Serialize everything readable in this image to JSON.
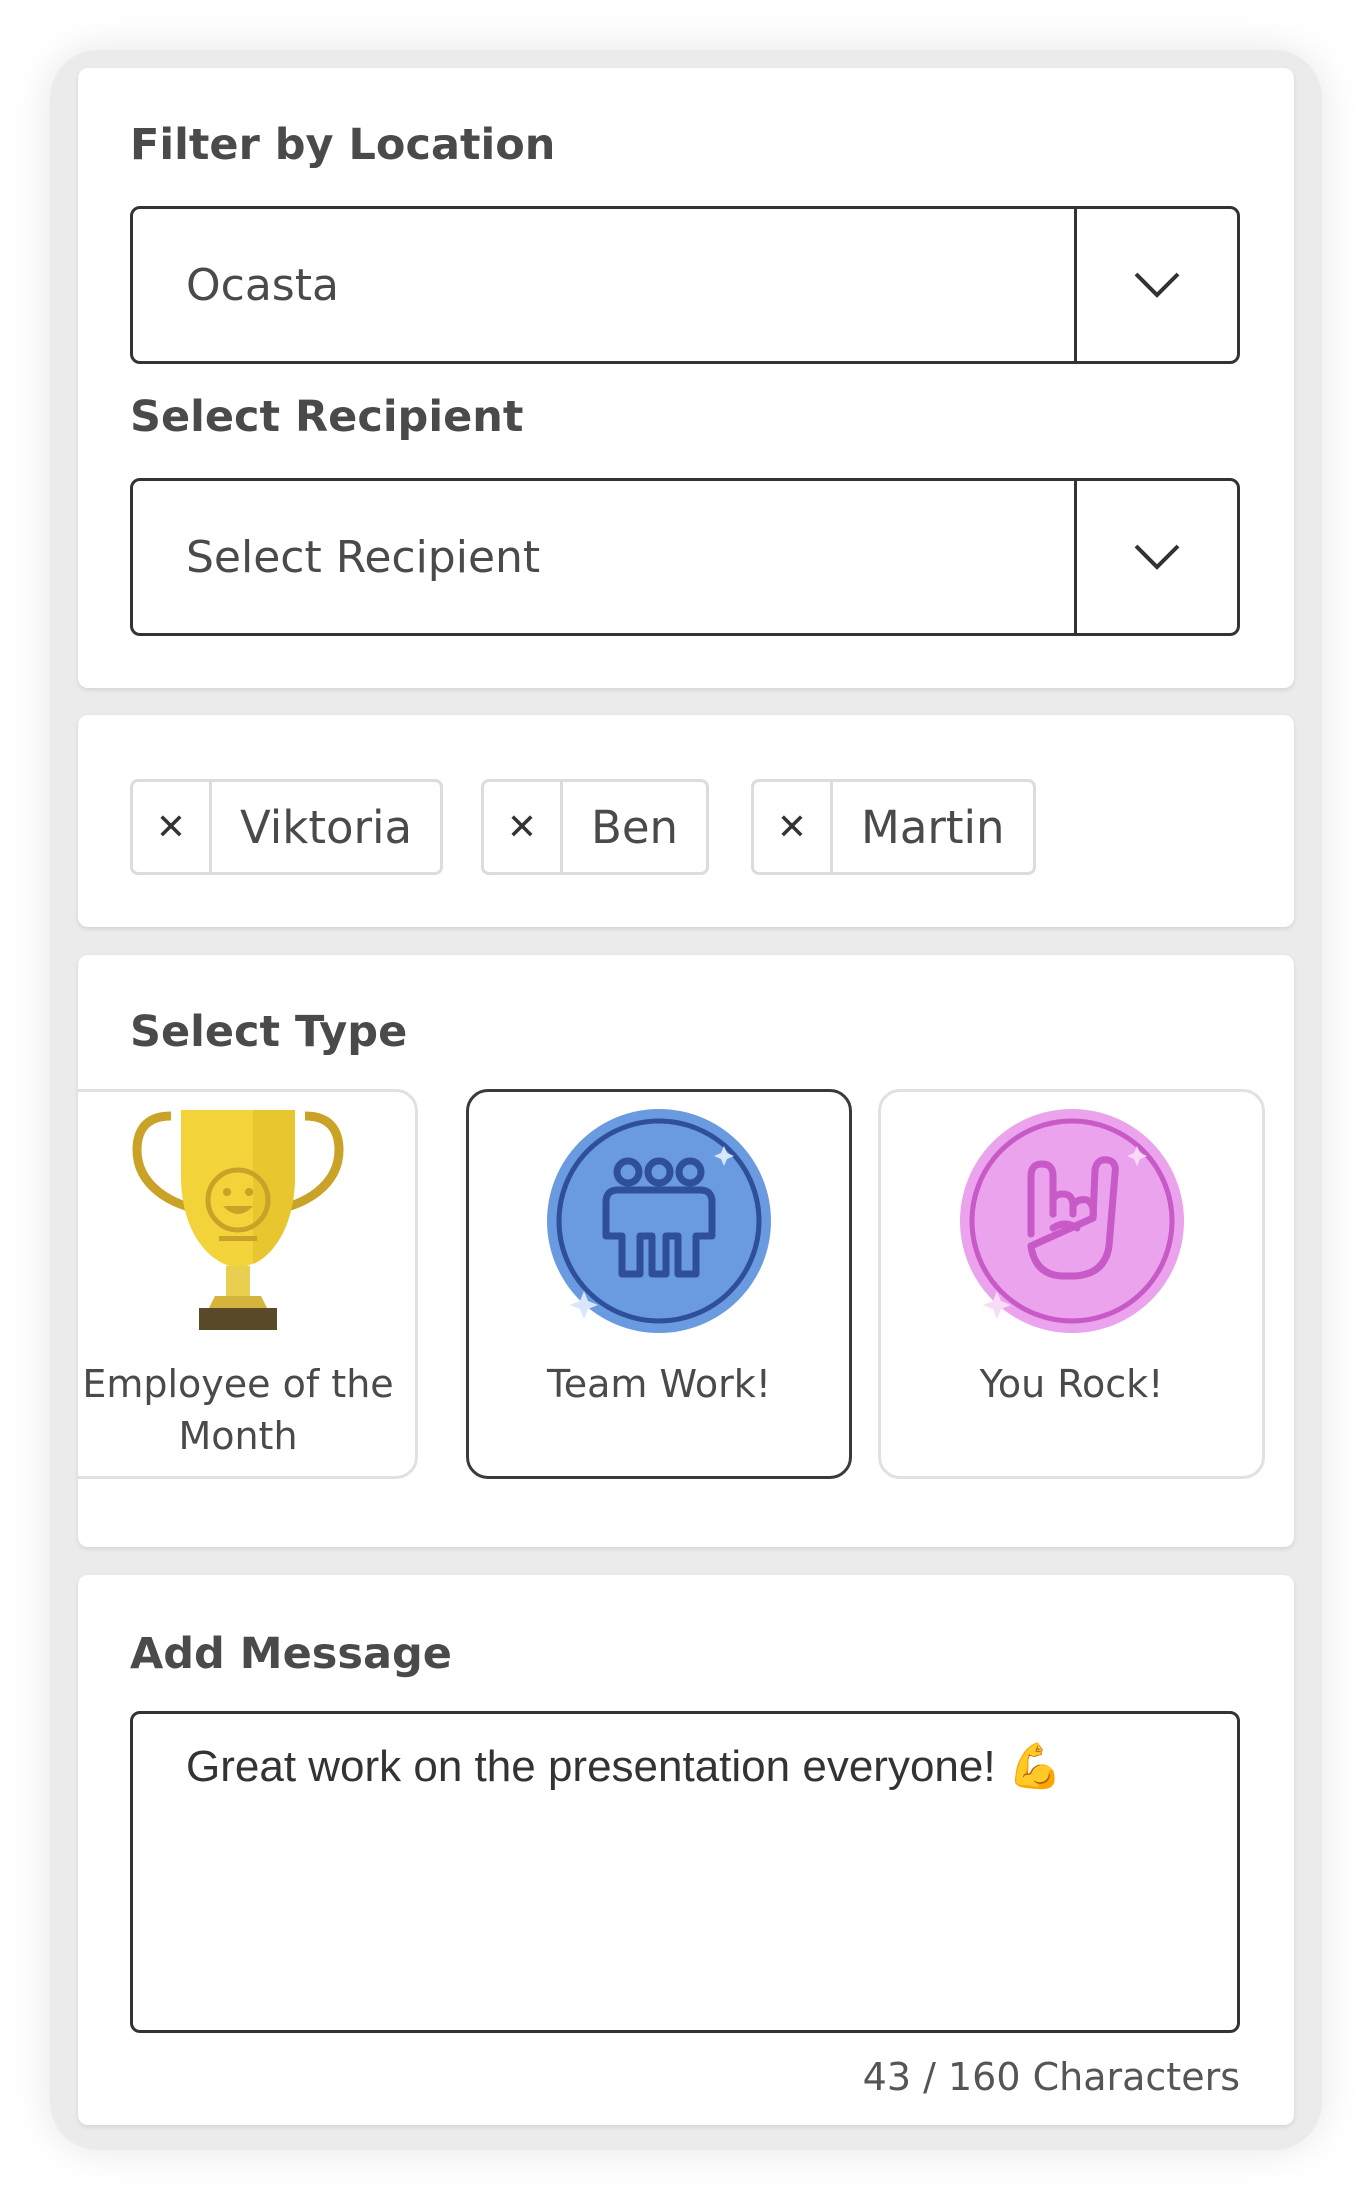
{
  "location": {
    "label": "Filter by Location",
    "value": "Ocasta"
  },
  "recipient": {
    "label": "Select Recipient",
    "placeholder": "Select Recipient"
  },
  "selected_recipients": [
    {
      "name": "Viktoria"
    },
    {
      "name": "Ben"
    },
    {
      "name": "Martin"
    }
  ],
  "type": {
    "label": "Select Type",
    "options": [
      {
        "label": "Employee of the Month",
        "icon": "trophy-icon",
        "color": "#f2d43a",
        "selected": false
      },
      {
        "label": "Team Work!",
        "icon": "team-icon",
        "color": "#6a9be0",
        "selected": true
      },
      {
        "label": "You Rock!",
        "icon": "rock-hand-icon",
        "color": "#eaa3ec",
        "selected": false
      }
    ]
  },
  "message": {
    "label": "Add Message",
    "text": "Great work on the presentation everyone! 💪",
    "counter": "43 / 160 Characters"
  }
}
